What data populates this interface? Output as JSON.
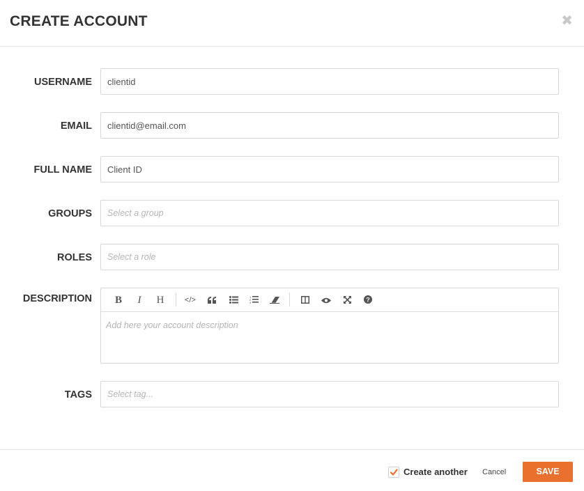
{
  "modal": {
    "title": "CREATE ACCOUNT",
    "close_icon": "close-icon"
  },
  "fields": {
    "username": {
      "label": "USERNAME",
      "value": "clientid"
    },
    "email": {
      "label": "EMAIL",
      "value": "clientid@email.com"
    },
    "fullname": {
      "label": "FULL NAME",
      "value": "Client ID"
    },
    "groups": {
      "label": "GROUPS",
      "placeholder": "Select a group"
    },
    "roles": {
      "label": "ROLES",
      "placeholder": "Select a role"
    },
    "description": {
      "label": "DESCRIPTION",
      "placeholder": "Add here your account description",
      "toolbar": [
        "bold-icon",
        "italic-icon",
        "heading-icon",
        "code-icon",
        "quote-icon",
        "unordered-list-icon",
        "ordered-list-icon",
        "eraser-icon",
        "side-by-side-icon",
        "preview-icon",
        "fullscreen-icon",
        "help-icon"
      ]
    },
    "tags": {
      "label": "TAGS",
      "placeholder": "Select tag..."
    }
  },
  "footer": {
    "create_another_label": "Create another",
    "create_another_checked": true,
    "cancel_label": "Cancel",
    "save_label": "SAVE"
  },
  "colors": {
    "accent": "#e9702e",
    "border": "#d7d7d7"
  }
}
